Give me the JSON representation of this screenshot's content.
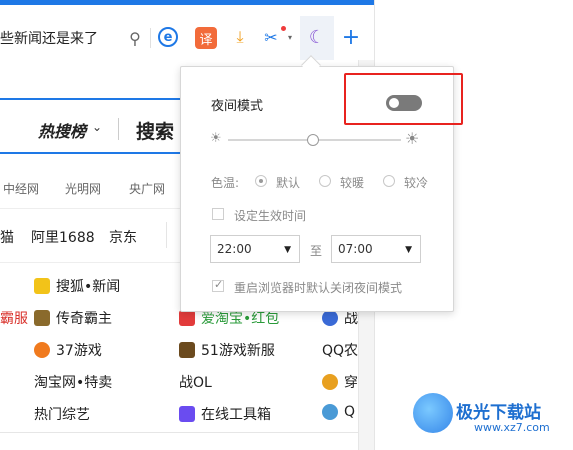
{
  "toolbar": {
    "address_text": "些新闻还是来了",
    "icons": [
      "search-icon",
      "q-icon",
      "translate-icon",
      "download-icon",
      "scissors-icon",
      "moon-icon",
      "plus-icon"
    ],
    "translate_glyph": "译",
    "moon_glyph": "☾",
    "plus_glyph": "+",
    "q_glyph": "e"
  },
  "hotsearch": {
    "label": "热搜榜",
    "arrow": "⌄",
    "search": "搜索"
  },
  "media": [
    "中经网",
    "光明网",
    "央广网"
  ],
  "shops": [
    "猫",
    "阿里1688",
    "京东"
  ],
  "links": [
    {
      "text": "搜狐•新闻",
      "col": 2
    },
    {
      "text": "传奇霸主",
      "col": 2
    },
    {
      "text": "37游戏",
      "col": 2
    },
    {
      "text": "淘宝网•特卖",
      "col": 2
    },
    {
      "text": "热门综艺",
      "col": 2
    },
    {
      "text": "51游戏新服",
      "col": 3
    },
    {
      "text": "战OL",
      "col": 3
    },
    {
      "text": "在线工具箱",
      "col": 3
    },
    {
      "text": "QQ农",
      "col": 4
    },
    {
      "text": "战",
      "col": 4
    },
    {
      "text": "穿",
      "col": 4
    },
    {
      "text": "Q",
      "col": 4
    },
    {
      "text": "爱淘宝•红包",
      "col": 3
    },
    {
      "text": "霸服",
      "col": 1
    }
  ],
  "night_popup": {
    "title": "夜间模式",
    "toggle_on": false,
    "color_temp_label": "色温:",
    "temps": [
      "默认",
      "较暖",
      "较冷"
    ],
    "selected_temp": "默认",
    "schedule_label": "设定生效时间",
    "schedule_checked": false,
    "start_time": "22:00",
    "to_label": "至",
    "end_time": "07:00",
    "restart_label": "重启浏览器时默认关闭夜间模式",
    "restart_checked": true,
    "brightness": 0.5
  },
  "watermark": {
    "brand": "极光下载站",
    "url": "www.xz7.com"
  },
  "colors": {
    "accent": "#1e78e6",
    "highlight": "#e8231f",
    "toggle": "#7a7a7a"
  }
}
